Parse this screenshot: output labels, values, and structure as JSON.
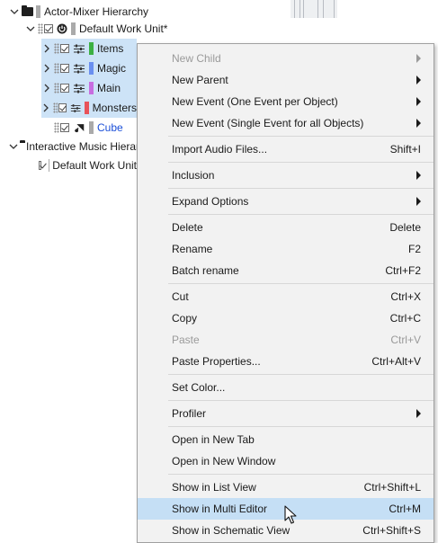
{
  "tree": {
    "rows": [
      {
        "label": "Actor-Mixer Hierarchy"
      },
      {
        "label": "Default Work Unit*"
      },
      {
        "label": "Items",
        "color": "#3cb043"
      },
      {
        "label": "Magic",
        "color": "#6a8ff0"
      },
      {
        "label": "Main",
        "color": "#c86de0"
      },
      {
        "label": "Monsters",
        "color": "#e8525a"
      },
      {
        "label": "Cube",
        "color": "#aaaaaa"
      },
      {
        "label": "Interactive Music Hierarchy"
      },
      {
        "label": "Default Work Unit"
      }
    ]
  },
  "context_menu": {
    "items": [
      {
        "label": "New Child",
        "shortcut": "",
        "submenu": true,
        "disabled": true
      },
      {
        "label": "New Parent",
        "shortcut": "",
        "submenu": true
      },
      {
        "label": "New Event (One Event per Object)",
        "shortcut": "",
        "submenu": true
      },
      {
        "label": "New Event (Single Event for all Objects)",
        "shortcut": "",
        "submenu": true
      },
      {
        "label": "Import Audio Files...",
        "shortcut": "Shift+I"
      },
      {
        "label": "Inclusion",
        "shortcut": "",
        "submenu": true
      },
      {
        "label": "Expand Options",
        "shortcut": "",
        "submenu": true
      },
      {
        "label": "Delete",
        "shortcut": "Delete"
      },
      {
        "label": "Rename",
        "shortcut": "F2"
      },
      {
        "label": "Batch rename",
        "shortcut": "Ctrl+F2"
      },
      {
        "label": "Cut",
        "shortcut": "Ctrl+X"
      },
      {
        "label": "Copy",
        "shortcut": "Ctrl+C"
      },
      {
        "label": "Paste",
        "shortcut": "Ctrl+V",
        "disabled": true
      },
      {
        "label": "Paste Properties...",
        "shortcut": "Ctrl+Alt+V"
      },
      {
        "label": "Set Color...",
        "shortcut": ""
      },
      {
        "label": "Profiler",
        "shortcut": "",
        "submenu": true
      },
      {
        "label": "Open in New Tab",
        "shortcut": ""
      },
      {
        "label": "Open in New Window",
        "shortcut": ""
      },
      {
        "label": "Show in List View",
        "shortcut": "Ctrl+Shift+L"
      },
      {
        "label": "Show in Multi Editor",
        "shortcut": "Ctrl+M",
        "highlighted": true
      },
      {
        "label": "Show in Schematic View",
        "shortcut": "Ctrl+Shift+S"
      }
    ]
  },
  "colors": {
    "selection": "#cde3f7",
    "menu_highlight": "#c5dff5",
    "menu_bg": "#f2f2f2"
  }
}
